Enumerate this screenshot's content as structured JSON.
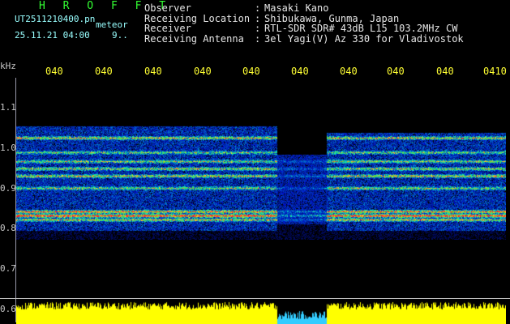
{
  "header": {
    "title": "H R O F F T",
    "filename": "UT2511210400.pn",
    "tag": "meteor",
    "datetime": "25.11.21 04:00",
    "count": "9.."
  },
  "meta": {
    "rows": [
      {
        "key": "Observer",
        "value": "Masaki Kano"
      },
      {
        "key": "Receiving Location",
        "value": "Shibukawa, Gunma, Japan"
      },
      {
        "key": "Receiver",
        "value": "RTL-SDR SDR# 43dB L15 103.2MHz CW"
      },
      {
        "key": "Receiving Antenna",
        "value": "3el Yagi(V) Az 330 for Vladivostok"
      }
    ],
    "separator": ":"
  },
  "axis": {
    "unit": "kHz",
    "y_ticks": [
      "1.1",
      "1.0",
      "0.9",
      "0.8",
      "0.7",
      "0.6"
    ],
    "x_ticks": [
      "040",
      "040",
      "040",
      "040",
      "040",
      "040",
      "040",
      "040",
      "040",
      "0410"
    ]
  },
  "colors": {
    "title": "#33ff33",
    "meta": "#e6e6e6",
    "ticks": "#ffff33",
    "amplitude": "#ffff00",
    "gap_amplitude": "#33ccff"
  }
}
